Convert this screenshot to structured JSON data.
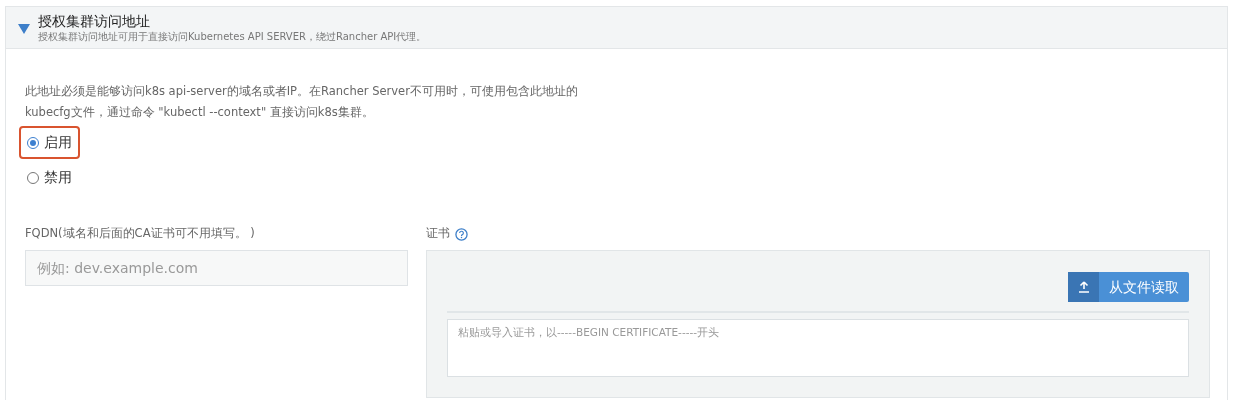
{
  "section": {
    "expanded": true,
    "title": "授权集群访问地址",
    "subtitle": "授权集群访问地址可用于直接访问Kubernetes API SERVER，绕过Rancher API代理。"
  },
  "description": [
    "此地址必须是能够访问k8s api-server的域名或者IP。在Rancher Server不可用时，可使用包含此地址的",
    "kubecfg文件，通过命令 \"kubectl --context\" 直接访问k8s集群。"
  ],
  "options": [
    {
      "label": "启用",
      "selected": true,
      "highlighted": true
    },
    {
      "label": "禁用",
      "selected": false,
      "highlighted": false
    }
  ],
  "fqdn": {
    "label": "FQDN(域名和后面的CA证书可不用填写。 )",
    "placeholder": "例如: dev.example.com"
  },
  "certificate": {
    "label": "证书",
    "read_button": "从文件读取",
    "placeholder": "粘贴或导入证书，以-----BEGIN CERTIFICATE-----开头"
  }
}
